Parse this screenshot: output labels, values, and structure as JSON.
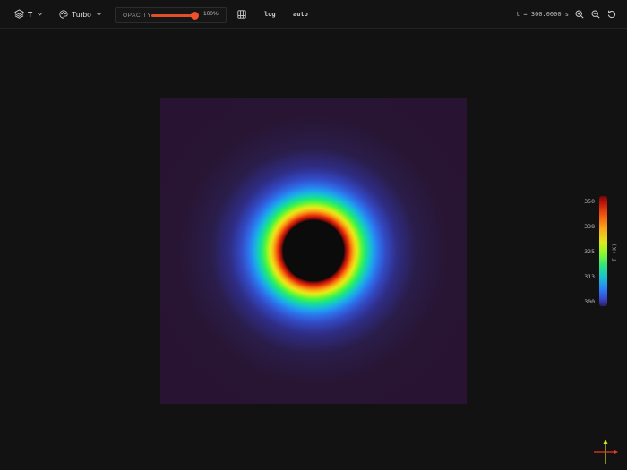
{
  "toolbar": {
    "field": {
      "label": "T",
      "icon": "layers-icon"
    },
    "colormap": {
      "label": "Turbo",
      "icon": "palette-icon"
    },
    "opacity": {
      "label": "OPACITY",
      "value_text": "100%",
      "value": 1.0
    },
    "grid_icon": "grid-icon",
    "log_label": "log",
    "auto_label": "auto",
    "time": "t = 300.0000 s",
    "zoom_in_icon": "zoom-in-icon",
    "zoom_out_icon": "zoom-out-icon",
    "reset_icon": "reset-icon"
  },
  "colorbar": {
    "title": "T (K)",
    "ticks": [
      "350",
      "338",
      "325",
      "313",
      "300"
    ],
    "colors": {
      "max": "#7a0505",
      "min": "#2e1f60"
    }
  },
  "plot": {
    "colors": {
      "background": "#281432",
      "hole": "#0b0b0b"
    }
  },
  "axes_gizmo": {
    "x_color": "#e53a2a",
    "y_color": "#d6e21a"
  }
}
